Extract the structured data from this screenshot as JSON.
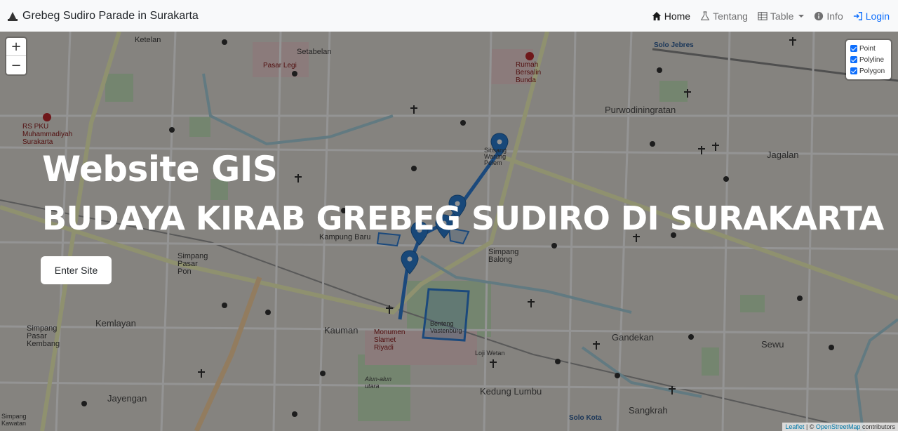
{
  "navbar": {
    "brand": "Grebeg Sudiro Parade in Surakarta",
    "items": [
      {
        "label": "Home",
        "icon": "home-icon"
      },
      {
        "label": "Tentang",
        "icon": "flask-icon"
      },
      {
        "label": "Table",
        "icon": "table-icon"
      },
      {
        "label": "Info",
        "icon": "info-icon"
      },
      {
        "label": "Login",
        "icon": "login-icon"
      }
    ]
  },
  "hero": {
    "title": "Website GIS",
    "subtitle": "BUDAYA KIRAB GREBEG SUDIRO DI SURAKARTA",
    "button": "Enter Site"
  },
  "map": {
    "zoom_in": "+",
    "zoom_out": "−",
    "layers": [
      "Point",
      "Polyline",
      "Polygon"
    ],
    "attribution": {
      "leaflet": "Leaflet",
      "sep": " | © ",
      "osm": "OpenStreetMap",
      "suffix": " contributors"
    },
    "labels": {
      "ketelan": "Ketelan",
      "setabelan": "Setabelan",
      "pasar_legi": "Pasar Legi",
      "rs_pku": "RS PKU Muhammadiyah Surakarta",
      "rumah_bersalin": "Rumah Bersalin Bunda",
      "solo_jebres": "Solo Jebres",
      "purwodiningratan": "Purwodiningratan",
      "jagalan": "Jagalan",
      "sitisang": "Sitisang Warung Pelem",
      "kampung_baru": "Kampung Baru",
      "simpang_balong": "Simpang Balong",
      "simpang_pasar_pon": "Simpang Pasar Pon",
      "kemlayan": "Kemlayan",
      "kauman": "Kauman",
      "monumen_slamet_riyadi": "Monumen Slamet Riyadi",
      "benteng": "Benteng Vastenburg",
      "simpang_pasar_kembang": "Simpang Pasar Kembang",
      "jayengan": "Jayengan",
      "alun_alun_utara": "Alun-alun utara",
      "kedung_lumbu": "Kedung Lumbu",
      "gandekan": "Gandekan",
      "sewu": "Sewu",
      "sangkrah": "Sangkrah",
      "solo_kota": "Solo Kota",
      "loji_wetan": "Loji Wetan",
      "simpang_kawatan": "Simpang Kawatan"
    }
  }
}
